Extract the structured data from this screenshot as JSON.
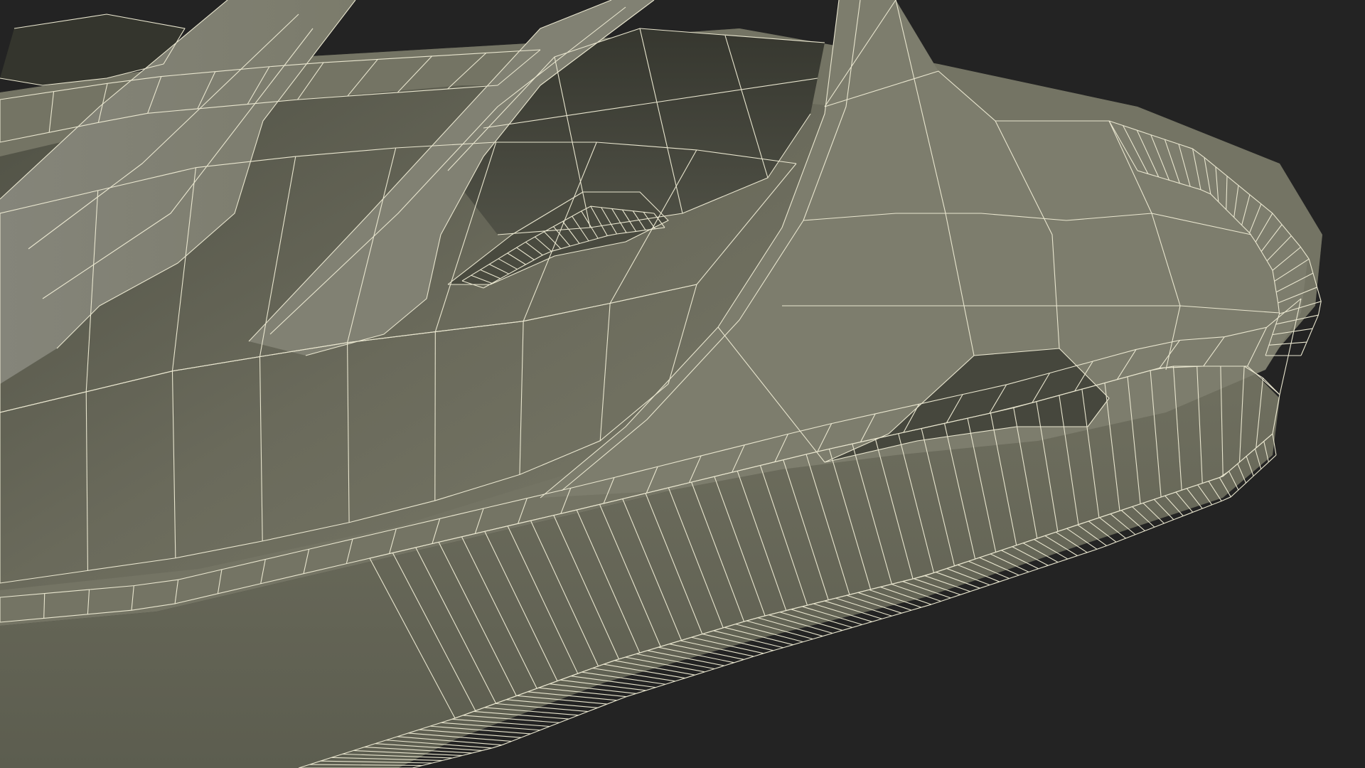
{
  "render": {
    "background": "#232323",
    "surface_color": "#7a7a69",
    "surface_shadow": "#4e4f43",
    "surface_deep": "#3a3b31",
    "wire_color": "#e9e6cf"
  },
  "subject": {
    "icon": "sandal-model-icon"
  }
}
